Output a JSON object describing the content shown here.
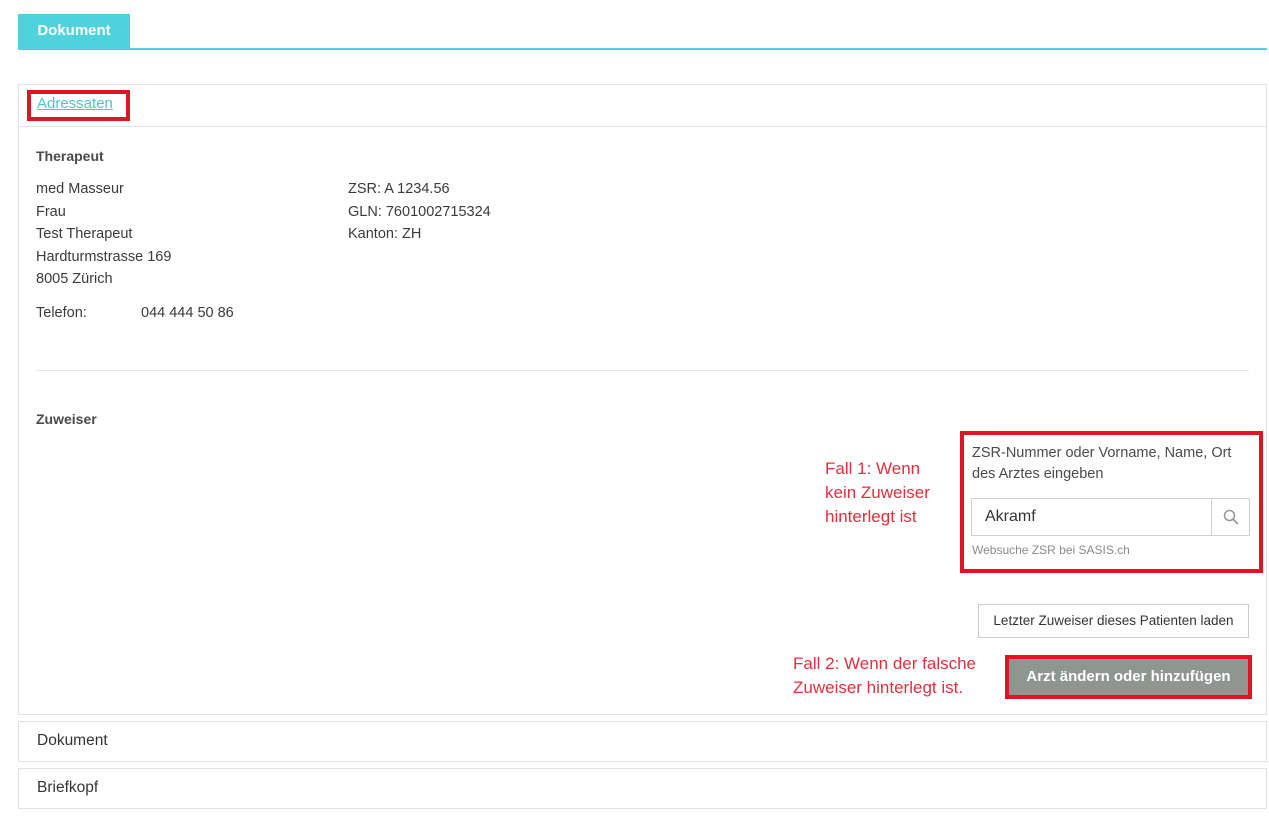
{
  "tabs": {
    "active": "Dokument"
  },
  "adressaten": {
    "link": "Adressaten"
  },
  "therapeut": {
    "title": "Therapeut",
    "lines": [
      "med Masseur",
      "Frau",
      "Test Therapeut",
      "Hardturmstrasse 169",
      "8005 Zürich"
    ],
    "ids": [
      "ZSR: A 1234.56",
      "GLN: 7601002715324",
      "Kanton: ZH"
    ],
    "phone_label": "Telefon:",
    "phone_value": "044 444 50 86"
  },
  "zuweiser": {
    "title": "Zuweiser",
    "search_label": "ZSR-Nummer oder Vorname, Name, Ort des Arztes eingeben",
    "search_value": "Akramf",
    "search_hint": "Websuche ZSR bei SASIS.ch",
    "load_last_label": "Letzter Zuweiser dieses Patienten laden",
    "change_label": "Arzt ändern oder hinzufügen"
  },
  "annotations": {
    "fall1": "Fall 1: Wenn kein Zuweiser hinterlegt ist",
    "fall2": "Fall 2: Wenn der falsche Zuweiser hinterlegt ist."
  },
  "sections": {
    "dokument": "Dokument",
    "briefkopf": "Briefkopf"
  },
  "colors": {
    "accent": "#4fd2dc",
    "highlight": "#e01424",
    "annotation": "#e0303e",
    "primary_button": "#8e9692"
  },
  "icons": {
    "search": "search-icon"
  }
}
